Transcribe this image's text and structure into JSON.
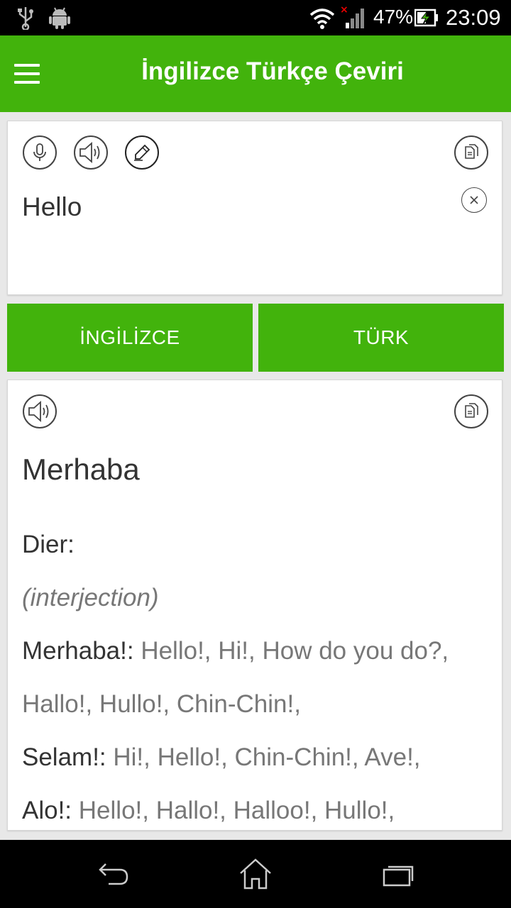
{
  "status_bar": {
    "battery": "47%",
    "time": "23:09",
    "icons": [
      "usb-icon",
      "android-icon",
      "wifi-icon",
      "signal-icon",
      "battery-charging-icon"
    ]
  },
  "app_bar": {
    "title": "İngilizce Türkçe Çeviri",
    "menu_icon": "hamburger-menu-icon"
  },
  "input_card": {
    "text": "Hello",
    "icons": [
      "microphone-icon",
      "speaker-icon",
      "pencil-icon",
      "copy-icon",
      "clear-icon"
    ]
  },
  "languages": {
    "source": "İNGİLİZCE",
    "target": "TÜRK"
  },
  "output_card": {
    "translation": "Merhaba",
    "other_label": "Dier:",
    "part_of_speech": "(interjection)",
    "entries": [
      {
        "term": "Merhaba!:",
        "meanings": " Hello!, Hi!, How do you do?,"
      },
      {
        "term": "",
        "meanings": "Hallo!, Hullo!, Chin-Chin!,"
      },
      {
        "term": "Selam!:",
        "meanings": " Hi!, Hello!, Chin-Chin!, Ave!,"
      },
      {
        "term": "Alo!:",
        "meanings": " Hello!, Hallo!, Halloo!, Hullo!,"
      }
    ],
    "icons": [
      "speaker-icon",
      "copy-icon"
    ]
  },
  "nav_bar": {
    "icons": [
      "back-icon",
      "home-icon",
      "recents-icon"
    ]
  },
  "colors": {
    "accent": "#42b30c",
    "text": "#333333",
    "muted": "#777777"
  }
}
